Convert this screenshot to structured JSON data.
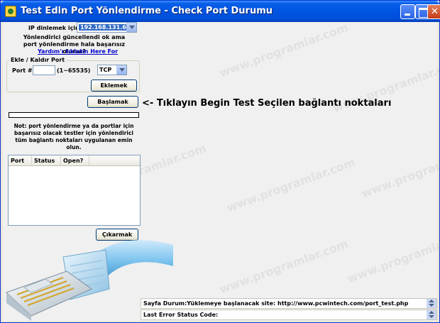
{
  "window": {
    "title": "Test Edin Port Yönlendirme - Check Port Durumu"
  },
  "ip": {
    "label": "IP dinlemek için:",
    "value": "192.168.131.65"
  },
  "help": {
    "text": "Yönlendirici güncellendi ok ama port yönlendirme hala başarısız olursa?",
    "link": "Yardım'ı tıklatın Here For"
  },
  "port_group": {
    "title": "Ekle / Kaldır Port",
    "port_label": "Port #:",
    "port_value": "",
    "range": "(1~65535)",
    "protocol": "TCP",
    "add_button": "Eklemek"
  },
  "start_button": "Başlamak",
  "hint": "<- Tıklayın Begin Test Seçilen bağlantı noktaları",
  "progress_fraction": 0,
  "note": "Not: port yönlendirme ya da portlar için başarısız olacak testler için yönlendirici tüm bağlantı noktaları uygulanan emin olun.",
  "list": {
    "columns": [
      "Port",
      "Status",
      "Open?"
    ]
  },
  "remove_button": "Çıkarmak",
  "status": {
    "page_status": "Sayfa Durum:Yüklemeye başlanacak site: http://www.pcwintech.com/port_test.php",
    "last_error": "Last Error Status Code:"
  },
  "watermark": "www.programlar.com",
  "colors": {
    "titlebar": "#0054e3",
    "selection": "#316ac5",
    "link": "#0000cc"
  }
}
